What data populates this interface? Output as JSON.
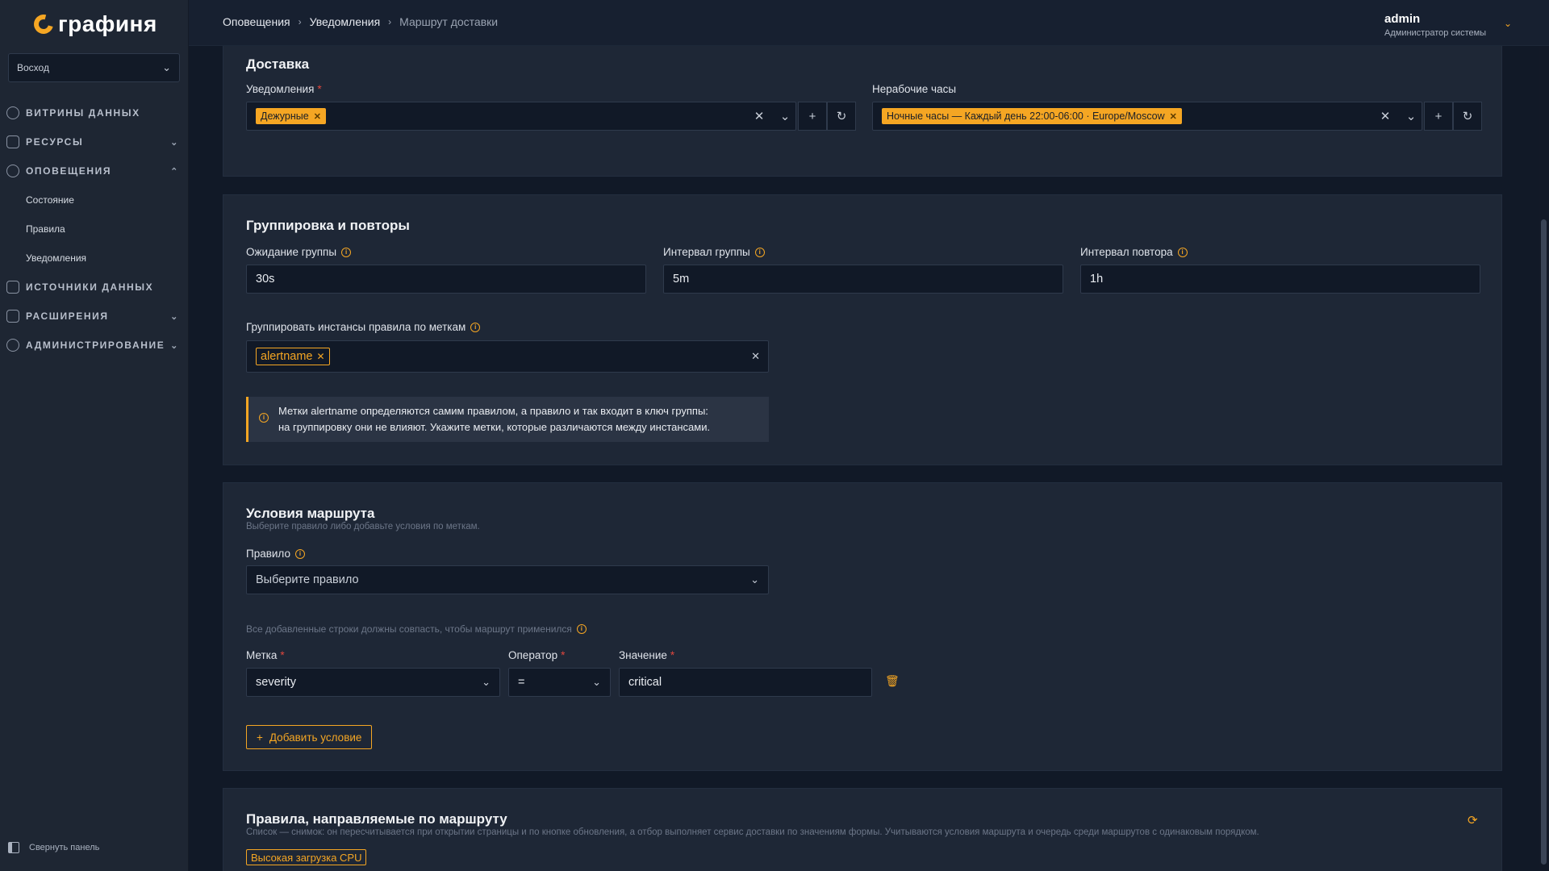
{
  "app": {
    "logo_text": "графиня"
  },
  "sidebar": {
    "org_select": "Восход",
    "items": [
      {
        "label": "Витрины данных",
        "icon": "dashboard-icon"
      },
      {
        "label": "Ресурсы",
        "icon": "layers-icon"
      },
      {
        "label": "Оповещения",
        "icon": "bell-icon"
      },
      {
        "label": "Источники данных",
        "icon": "database-icon"
      },
      {
        "label": "Расширения",
        "icon": "plug-icon"
      },
      {
        "label": "Администрирование",
        "icon": "gear-icon"
      }
    ],
    "sub_items": [
      "Состояние",
      "Правила",
      "Уведомления"
    ],
    "collapse_label": "Свернуть панель"
  },
  "header": {
    "breadcrumb": [
      "Оповещения",
      "Уведомления",
      "Маршрут доставки"
    ],
    "user_name": "admin",
    "user_role": "Администратор системы"
  },
  "delivery": {
    "title": "Доставка",
    "notifications_label": "Уведомления",
    "notifications_tag": "Дежурные",
    "offhours_label": "Нерабочие часы",
    "offhours_tag": "Ночные часы — Каждый день 22:00-06:00 · Europe/Moscow"
  },
  "grouping": {
    "title": "Группировка и повторы",
    "group_wait_label": "Ожидание группы",
    "group_wait_value": "30s",
    "group_interval_label": "Интервал группы",
    "group_interval_value": "5m",
    "repeat_interval_label": "Интервал повтора",
    "repeat_interval_value": "1h",
    "group_by_label": "Группировать инстансы правила по меткам",
    "group_by_tag": "alertname",
    "callout_line1": "Метки alertname определяются самим правилом, а правило и так входит в ключ группы:",
    "callout_line2": "на группировку они не влияют. Укажите метки, которые различаются между инстансами."
  },
  "conditions": {
    "title": "Условия маршрута",
    "subtitle": "Выберите правило либо добавьте условия по меткам.",
    "rule_label": "Правило",
    "rule_placeholder": "Выберите правило",
    "hint": "Все добавленные строки должны совпасть, чтобы маршрут применился",
    "label_col": "Метка",
    "operator_col": "Оператор",
    "value_col": "Значение",
    "row_label": "severity",
    "row_operator": "=",
    "row_value": "critical",
    "add_button": "Добавить условие"
  },
  "routed": {
    "title": "Правила, направляемые по маршруту",
    "subtitle": "Список — снимок: он пересчитывается при открытии страницы и по кнопке обновления, а отбор выполняет сервис доставки по значениям формы. Учитываются условия маршрута и очередь среди маршрутов с одинаковым порядком.",
    "rule_tag": "Высокая загрузка CPU"
  },
  "colors": {
    "accent": "#f5a623",
    "background": "#111927",
    "card": "#1e2736",
    "required": "#e0463d"
  }
}
